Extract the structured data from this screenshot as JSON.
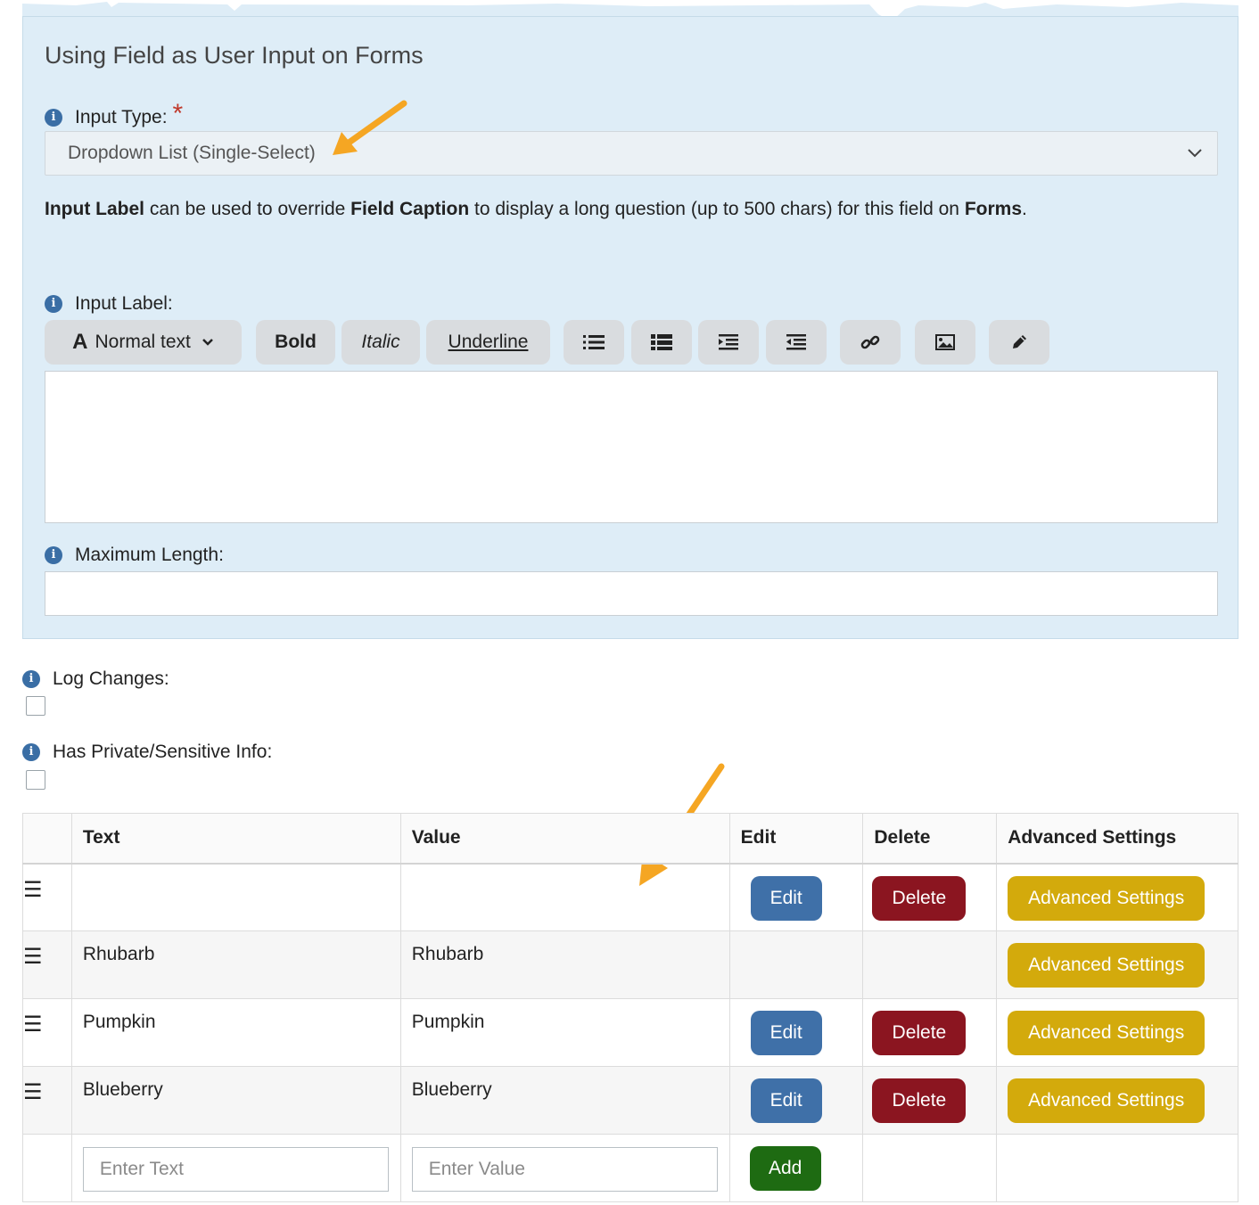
{
  "panel": {
    "title": "Using Field as User Input on Forms",
    "input_type_label": "Input Type:",
    "required_mark": "*",
    "input_type_value": "Dropdown List (Single-Select)",
    "help": {
      "part1": "Input Label",
      "part2": " can be used to override ",
      "part3": "Field Caption",
      "part4": " to display a long question (up to 500 chars) for this field on ",
      "part5": "Forms",
      "part6": "."
    },
    "input_label_label": "Input Label:",
    "toolbar": {
      "format": "Normal text",
      "bold": "Bold",
      "italic": "Italic",
      "underline": "Underline"
    },
    "max_length_label": "Maximum Length:"
  },
  "log_changes_label": "Log Changes:",
  "private_info_label": "Has Private/Sensitive Info:",
  "table": {
    "headers": {
      "text": "Text",
      "value": "Value",
      "edit": "Edit",
      "delete": "Delete",
      "advanced": "Advanced Settings"
    },
    "rows": [
      {
        "text": "",
        "value": "",
        "edit": "Edit",
        "delete": "Delete",
        "advanced": "Advanced Settings"
      },
      {
        "text": "Rhubarb",
        "value": "Rhubarb",
        "advanced": "Advanced Settings"
      },
      {
        "text": "Pumpkin",
        "value": "Pumpkin",
        "edit": "Edit",
        "delete": "Delete",
        "advanced": "Advanced Settings"
      },
      {
        "text": "Blueberry",
        "value": "Blueberry",
        "edit": "Edit",
        "delete": "Delete",
        "advanced": "Advanced Settings"
      }
    ],
    "new_row": {
      "text_placeholder": "Enter Text",
      "value_placeholder": "Enter Value",
      "add": "Add"
    }
  },
  "colors": {
    "panel_bg": "#deedf7",
    "edit": "#3f70a8",
    "delete": "#8b1520",
    "advanced": "#d3aa0c",
    "add": "#1e6b12",
    "arrow": "#f5a623"
  }
}
